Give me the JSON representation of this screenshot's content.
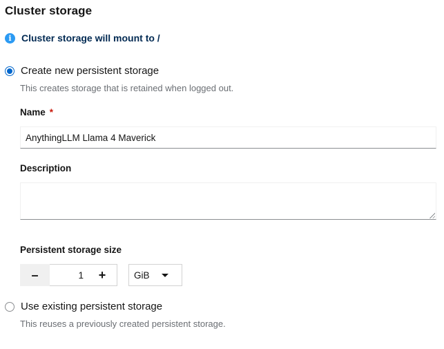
{
  "section": {
    "title": "Cluster storage"
  },
  "alert": {
    "icon": "info-circle-icon",
    "text": "Cluster storage will mount to /"
  },
  "create_option": {
    "label": "Create new persistent storage",
    "helper": "This creates storage that is retained when logged out.",
    "selected": true
  },
  "name_field": {
    "label": "Name",
    "required_mark": "*",
    "value": "AnythingLLM Llama 4 Maverick"
  },
  "description_field": {
    "label": "Description",
    "value": ""
  },
  "size_field": {
    "label": "Persistent storage size",
    "minus_label": "–",
    "value": "1",
    "plus_label": "+",
    "unit": "GiB"
  },
  "existing_option": {
    "label": "Use existing persistent storage",
    "helper": "This reuses a previously created persistent storage.",
    "selected": false
  },
  "colors": {
    "accent": "#0066cc",
    "info": "#2b9af3",
    "required": "#c9190b",
    "helper": "#6a6e73"
  }
}
